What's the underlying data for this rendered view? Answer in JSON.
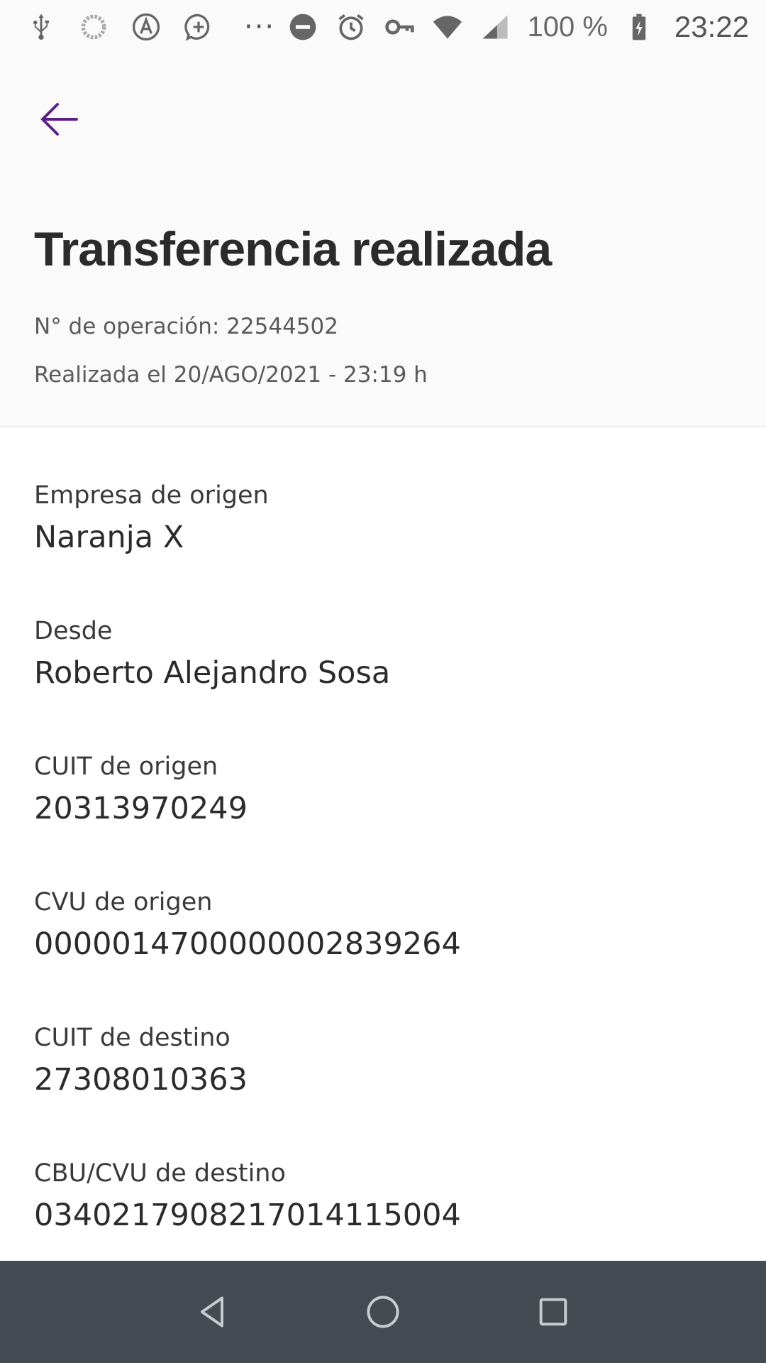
{
  "status_bar": {
    "icons_left": [
      "usb-icon",
      "loading-icon",
      "a-icon",
      "add-circle-icon"
    ],
    "more": "···",
    "icons_right": [
      "dnd-icon",
      "alarm-icon",
      "key-icon",
      "wifi-icon",
      "signal-icon"
    ],
    "battery_percent": "100 %",
    "battery_icon": "battery-charging-icon",
    "time": "23:22"
  },
  "header": {
    "back_icon": "arrow-left-icon",
    "title": "Transferencia realizada",
    "operation_number": "N° de operación: 22544502",
    "date": "Realizada el 20/AGO/2021 - 23:19 h"
  },
  "details": [
    {
      "label": "Empresa de origen",
      "value": "Naranja X"
    },
    {
      "label": "Desde",
      "value": "Roberto Alejandro Sosa"
    },
    {
      "label": "CUIT de origen",
      "value": "20313970249"
    },
    {
      "label": "CVU de origen",
      "value": "0000014700000002839264"
    },
    {
      "label": "CUIT de destino",
      "value": "27308010363"
    },
    {
      "label": "CBU/CVU de destino",
      "value": "0340217908217014115004"
    }
  ],
  "nav": {
    "back_icon": "triangle-back-icon",
    "home_icon": "circle-home-icon",
    "recents_icon": "square-recents-icon"
  },
  "colors": {
    "accent": "#5c1f87",
    "nav_bg": "#454b52"
  }
}
